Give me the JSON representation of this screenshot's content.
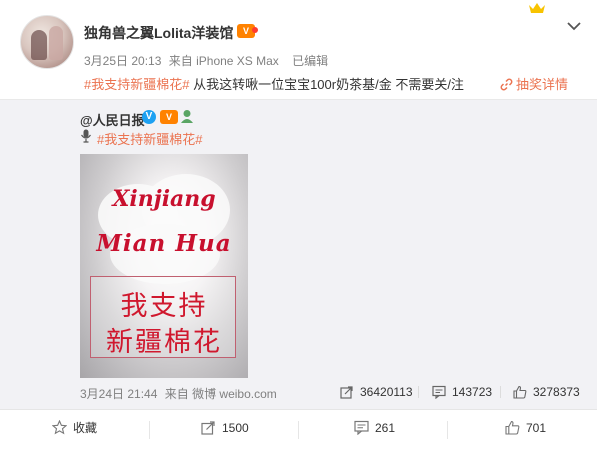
{
  "post": {
    "user_name": "独角兽之翼Lolita洋装馆",
    "timestamp": "3月25日 20:13",
    "source_prefix": "来自",
    "device": "iPhone XS Max",
    "edited": "已编辑",
    "hashtag": "#我支持新疆棉花#",
    "body": " 从我这转啾一位宝宝100r奶茶基/金 不需要关/注",
    "lottery_label": "抽奖详情",
    "vip_badge": "V"
  },
  "repost": {
    "user": "@人民日报",
    "v_badge": "V",
    "vip_badge": "V",
    "hashtag": "#我支持新疆棉花#",
    "image_text": {
      "line1": "Xinjiang",
      "line2": "Mian Hua",
      "line3": "我支持",
      "line4": "新疆棉花"
    },
    "timestamp": "3月24日 21:44",
    "source": "来自 微博 weibo.com",
    "reposts": "36420113",
    "comments": "143723",
    "likes": "3278373"
  },
  "actions": {
    "favorite": "收藏",
    "repost": "1500",
    "comment": "261",
    "like": "701"
  },
  "colors": {
    "tag": "#eb7350",
    "panel": "#f2f2f5",
    "accent": "#ff8200"
  }
}
